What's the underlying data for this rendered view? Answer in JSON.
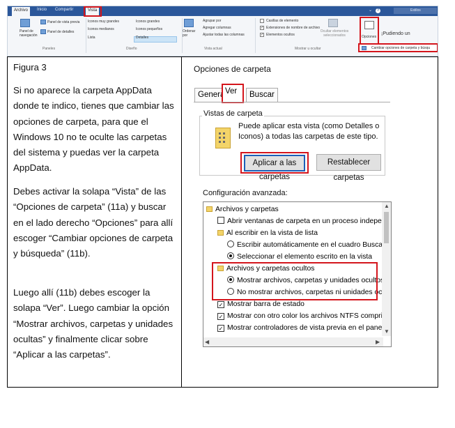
{
  "ribbon": {
    "tabs": [
      "Archivo",
      "Inicio",
      "Compartir",
      "Vista"
    ],
    "search_placeholder": "Estilos",
    "help_label": "?",
    "panes": {
      "navigation_pane": "Panel de navegación",
      "preview_pane": "Panel de vista previa",
      "details_pane": "Panel de detalles",
      "group_label": "Paneles"
    },
    "layout": {
      "very_large_icons": "Iconos muy grandes",
      "large_icons": "Iconos grandes",
      "medium_icons": "Iconos medianos",
      "small_icons": "Iconos pequeños",
      "list": "Lista",
      "details": "Detalles",
      "group_label": "Diseño"
    },
    "current_view": {
      "sort_by": "Ordenar por",
      "group_by": "Agrupar por",
      "add_columns": "Agregar columnas",
      "fit_columns": "Ajustar todas las columnas",
      "group_label": "Vista actual"
    },
    "show_hide": {
      "item_checkboxes": "Casillas de elemento",
      "file_extensions": "Extensiones de nombre de archivo",
      "hidden_items": "Elementos ocultos",
      "hide_selected": "Ocultar elementos seleccionados",
      "group_label": "Mostrar u ocultar"
    },
    "options": {
      "label": "Opciones",
      "extra": "¡Pudiendo un",
      "change_options": "Cambiar opciones de carpeta y búsqu"
    }
  },
  "left_cell": {
    "figure_title": "Figura 3",
    "para1": "Si no aparece la carpeta AppData donde te indico, tienes que cambiar las opciones de carpeta, para que el Windows 10 no te oculte las carpetas del sistema y puedas ver la carpeta AppData.",
    "para2": "Debes activar la solapa “Vista” de las “Opciones de carpeta”  (11a) y buscar en el lado derecho “Opciones” para allí escoger “Cambiar opciones de carpeta y búsqueda” (11b).",
    "para3": "Luego allí (11b) debes escoger  la solapa “Ver”. Luego cambiar la opción “Mostrar archivos, carpetas y unidades ocultas” y finalmente clicar sobre  “Aplicar a las carpetas”."
  },
  "dialog": {
    "title": "Opciones de carpeta",
    "tabs": [
      "General",
      "Ver",
      "Buscar"
    ],
    "vistas_legend": "Vistas de carpeta",
    "vistas_desc": "Puede aplicar esta vista (como Detalles o Iconos) a todas las carpetas de este tipo.",
    "btn_apply": "Aplicar a las carpetas",
    "btn_reset": "Restablecer carpetas",
    "advanced_label": "Configuración avanzada:",
    "tree": [
      "Archivos y carpetas",
      "Abrir ventanas de carpeta en un proceso independiente",
      "Al escribir en la vista de lista",
      "Escribir automáticamente en el cuadro Buscar",
      "Seleccionar el elemento escrito en la vista",
      "Archivos y carpetas ocultos",
      "Mostrar archivos, carpetas y unidades ocultos",
      "No mostrar archivos, carpetas ni unidades ocultos",
      "Mostrar barra de estado",
      "Mostrar con otro color los archivos NTFS comprimidos o c",
      "Mostrar controladores de vista previa en el panel de vista"
    ]
  }
}
